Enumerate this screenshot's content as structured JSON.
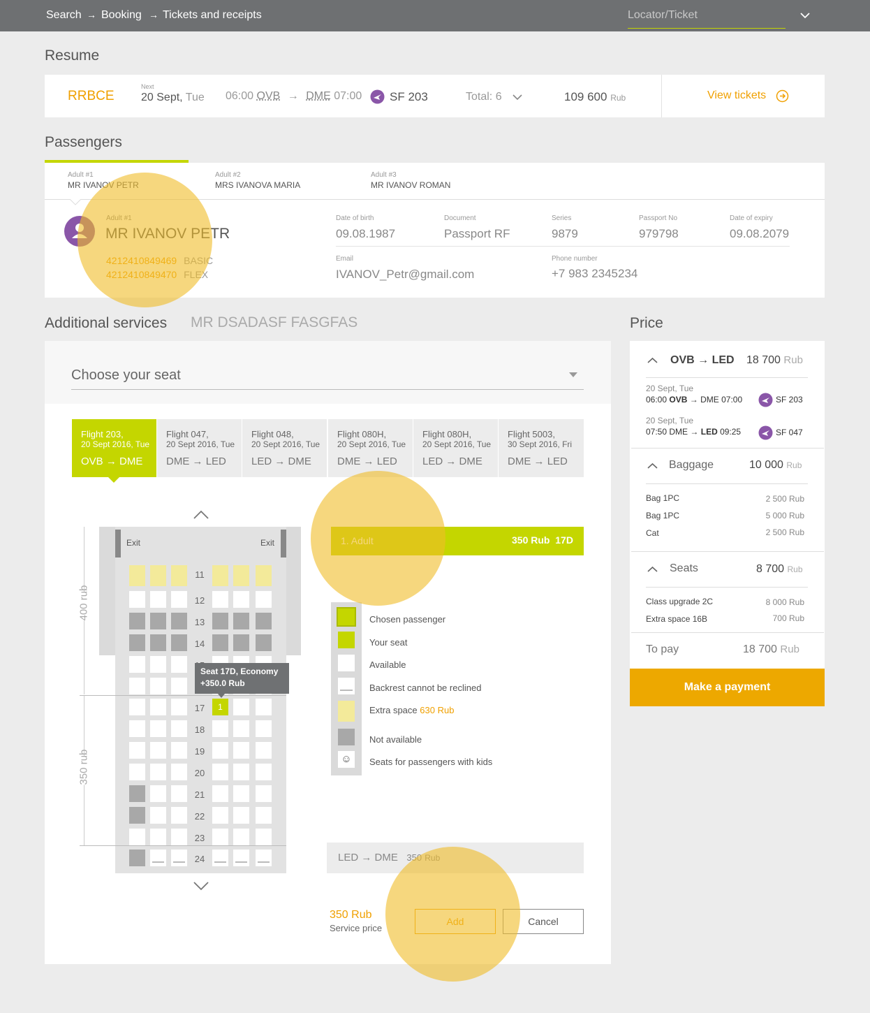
{
  "breadcrumb": {
    "items": [
      "Search",
      "Booking",
      "Tickets and receipts"
    ],
    "locator_placeholder": "Locator/Ticket"
  },
  "resume": {
    "title": "Resume",
    "pnr": "RRBCE",
    "next_label": "Next",
    "date": "20 Sept,",
    "weekday": "Tue",
    "dep_time": "06:00",
    "from": "OVB",
    "to": "DME",
    "arr_time": "07:00",
    "flight": "SF 203",
    "total_label": "Total:",
    "total_count": "6",
    "amount": "109 600",
    "currency": "Rub",
    "view_tickets": "View tickets"
  },
  "passengers": {
    "title": "Passengers",
    "tabs": [
      {
        "kind": "Adult #1",
        "name": "MR IVANOV PETR"
      },
      {
        "kind": "Adult #2",
        "name": "MRS IVANOVA MARIA"
      },
      {
        "kind": "Adult #3",
        "name": "MR IVANOV ROMAN"
      }
    ],
    "detail": {
      "kind": "Adult #1",
      "name": "MR IVANOV PETR",
      "tickets": [
        {
          "number": "4212410849469",
          "fare": "BASIC"
        },
        {
          "number": "4212410849470",
          "fare": "FLEX"
        }
      ],
      "dob_label": "Date of birth",
      "dob": "09.08.1987",
      "doc_label": "Document",
      "doc": "Passport RF",
      "series_label": "Series",
      "series": "9879",
      "passport_label": "Passport No",
      "passport": "979798",
      "expiry_label": "Date of expiry",
      "expiry": "09.08.2079",
      "email_label": "Email",
      "email": "IVANOV_Petr@gmail.com",
      "phone_label": "Phone number",
      "phone": "+7 983 2345234"
    }
  },
  "services": {
    "title": "Additional services",
    "passenger": "MR DSADASF FASGFAS",
    "select_label": "Choose your seat",
    "flights": [
      {
        "line1": "Flight 203,",
        "line2": "20 Sept 2016, Tue",
        "route_from": "OVB",
        "route_to": "DME"
      },
      {
        "line1": "Flight 047,",
        "line2": "20 Sept 2016, Tue",
        "route_from": "DME",
        "route_to": "LED"
      },
      {
        "line1": "Flight 048,",
        "line2": "20 Sept 2016, Tue",
        "route_from": "LED",
        "route_to": "DME"
      },
      {
        "line1": "Flight 080H,",
        "line2": "20 Sept 2016, Tue",
        "route_from": "DME",
        "route_to": "LED"
      },
      {
        "line1": "Flight 080H,",
        "line2": "20 Sept 2016, Tue",
        "route_from": "LED",
        "route_to": "DME"
      },
      {
        "line1": "Flight 5003,",
        "line2": "30 Sept 2016, Fri",
        "route_from": "DME",
        "route_to": "LED"
      }
    ],
    "exit_left": "Exit",
    "exit_right": "Exit",
    "zone_top": "400 rub",
    "zone_bottom": "350 rub",
    "rows": [
      "11",
      "12",
      "13",
      "14",
      "15",
      "16",
      "17",
      "18",
      "19",
      "20",
      "21",
      "22",
      "23",
      "24"
    ],
    "tooltip_line1": "Seat 17D,  Economy",
    "tooltip_line2": "+350.0 Rub",
    "selected_seat_mark": "1",
    "passenger_bar": {
      "label": "1. Adult",
      "price": "350 Rub",
      "seat": "17D"
    },
    "legend": [
      {
        "label": "Chosen passenger"
      },
      {
        "label": "Your seat"
      },
      {
        "label": "Available"
      },
      {
        "label": "Backrest cannot be reclined"
      },
      {
        "label": "Extra space",
        "extra": "630 Rub"
      },
      {
        "label": "Not available"
      },
      {
        "label": "Seats for passengers with kids"
      }
    ],
    "segment": {
      "from": "LED",
      "to": "DME",
      "price": "350",
      "currency": "Rub"
    },
    "service_price": "350 Rub",
    "service_price_label": "Service price",
    "add_label": "Add",
    "cancel_label": "Cancel"
  },
  "price": {
    "title": "Price",
    "route_from": "OVB",
    "route_to": "LED",
    "route_amount": "18 700",
    "currency": "Rub",
    "segments": [
      {
        "date": "20 Sept, Tue",
        "dep": "06:00",
        "from": "OVB",
        "to": "DME",
        "arr": "07:00",
        "flight": "SF 203"
      },
      {
        "date": "20 Sept, Tue",
        "dep": "07:50",
        "from": "DME",
        "to": "LED",
        "arr": "09:25",
        "flight": "SF 047"
      }
    ],
    "baggage": {
      "label": "Baggage",
      "amount": "10 000",
      "items": [
        {
          "name": "Bag 1PC",
          "amount": "2 500"
        },
        {
          "name": "Bag 1PC",
          "amount": "5 000"
        },
        {
          "name": "Cat",
          "amount": "2 500"
        }
      ]
    },
    "seats": {
      "label": "Seats",
      "amount": "8 700",
      "items": [
        {
          "name": "Class upgrade 2C",
          "amount": "8 000"
        },
        {
          "name": "Extra space 16B",
          "amount": "700"
        }
      ]
    },
    "to_pay_label": "To pay",
    "to_pay": "18 700",
    "pay_button": "Make a payment"
  },
  "colors": {
    "accent_green": "#c4d600",
    "accent_orange": "#f0a000",
    "topbar": "#6e7072"
  }
}
